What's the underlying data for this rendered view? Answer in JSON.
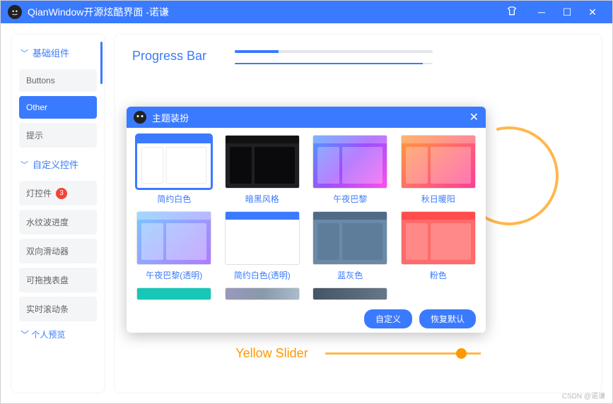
{
  "window": {
    "title": "QianWindow开源炫酷界面    -诺谦"
  },
  "sidebar": {
    "group1": "基础组件",
    "group2": "自定义控件",
    "items": {
      "buttons": "Buttons",
      "other": "Other",
      "tips": "提示",
      "lamp": "灯控件",
      "lamp_badge": "3",
      "water": "水纹波进度",
      "dual_slider": "双向滑动器",
      "dial": "可拖拽表盘",
      "scroll": "实时滚动条"
    },
    "cutoff": "个人预览"
  },
  "main": {
    "progress_title": "Progress Bar",
    "yellow_title": "Yellow Slider"
  },
  "dialog": {
    "title": "主题装扮",
    "themes": [
      {
        "label": "简约白色"
      },
      {
        "label": "暗黑风格"
      },
      {
        "label": "午夜巴黎"
      },
      {
        "label": "秋日暖阳"
      },
      {
        "label": "午夜巴黎(透明)"
      },
      {
        "label": "简约白色(透明)"
      },
      {
        "label": "蓝灰色"
      },
      {
        "label": "粉色"
      }
    ],
    "custom_btn": "自定义",
    "reset_btn": "恢复默认"
  },
  "watermark": "CSDN @诺谦"
}
